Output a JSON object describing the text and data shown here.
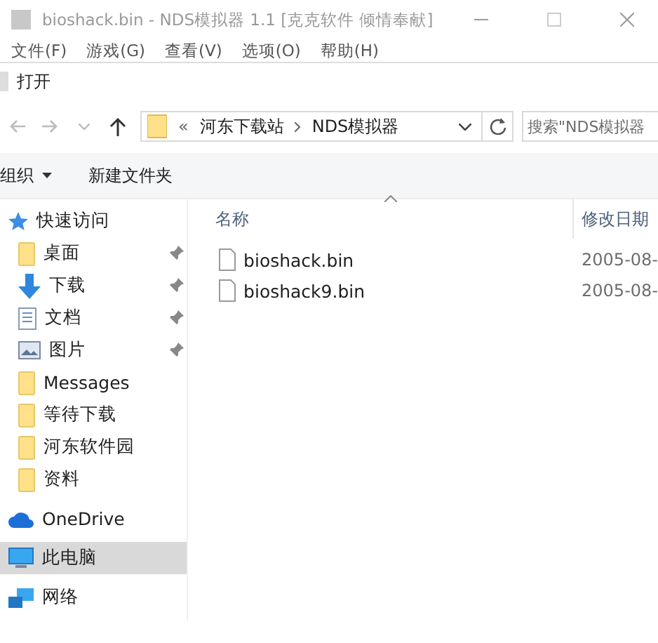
{
  "background_window": {
    "title": "bioshack.bin - NDS模拟器 1.1 [克克软件 倾情奉献]",
    "menu": [
      "文件(F)",
      "游戏(G)",
      "查看(V)",
      "选项(O)",
      "帮助(H)"
    ]
  },
  "dialog": {
    "title": "打开",
    "address": {
      "overflow": "«",
      "path": [
        "河东下载站",
        "NDS模拟器"
      ]
    },
    "search": {
      "placeholder": "搜索\"NDS模拟器"
    },
    "toolbar": [
      {
        "kind": "menu",
        "label": "组织"
      },
      {
        "kind": "button",
        "label": "新建文件夹"
      }
    ],
    "sidebar": {
      "items": [
        {
          "kind": "star",
          "label": "快速访问",
          "selected": false,
          "children": [
            {
              "kind": "folder",
              "label": "桌面",
              "pinned": true,
              "selected": false
            },
            {
              "kind": "download",
              "label": "下载",
              "pinned": true,
              "selected": false
            },
            {
              "kind": "document",
              "label": "文档",
              "pinned": true,
              "selected": false
            },
            {
              "kind": "image",
              "label": "图片",
              "pinned": true,
              "selected": false
            },
            {
              "kind": "folder",
              "label": "Messages",
              "pinned": false,
              "selected": false
            },
            {
              "kind": "folder",
              "label": "等待下载",
              "pinned": false,
              "selected": false
            },
            {
              "kind": "folder",
              "label": "河东软件园",
              "pinned": false,
              "selected": false
            },
            {
              "kind": "folder",
              "label": "资料",
              "pinned": false,
              "selected": false
            }
          ]
        },
        {
          "kind": "cloud",
          "label": "OneDrive",
          "selected": false
        },
        {
          "kind": "pc",
          "label": "此电脑",
          "selected": true
        },
        {
          "kind": "network",
          "label": "网络",
          "selected": false
        }
      ]
    },
    "table": {
      "columns": [
        "名称",
        "修改日期"
      ],
      "rows": [
        {
          "name": "bioshack.bin",
          "modified": "2005-08-"
        },
        {
          "name": "bioshack9.bin",
          "modified": "2005-08-"
        }
      ]
    }
  }
}
